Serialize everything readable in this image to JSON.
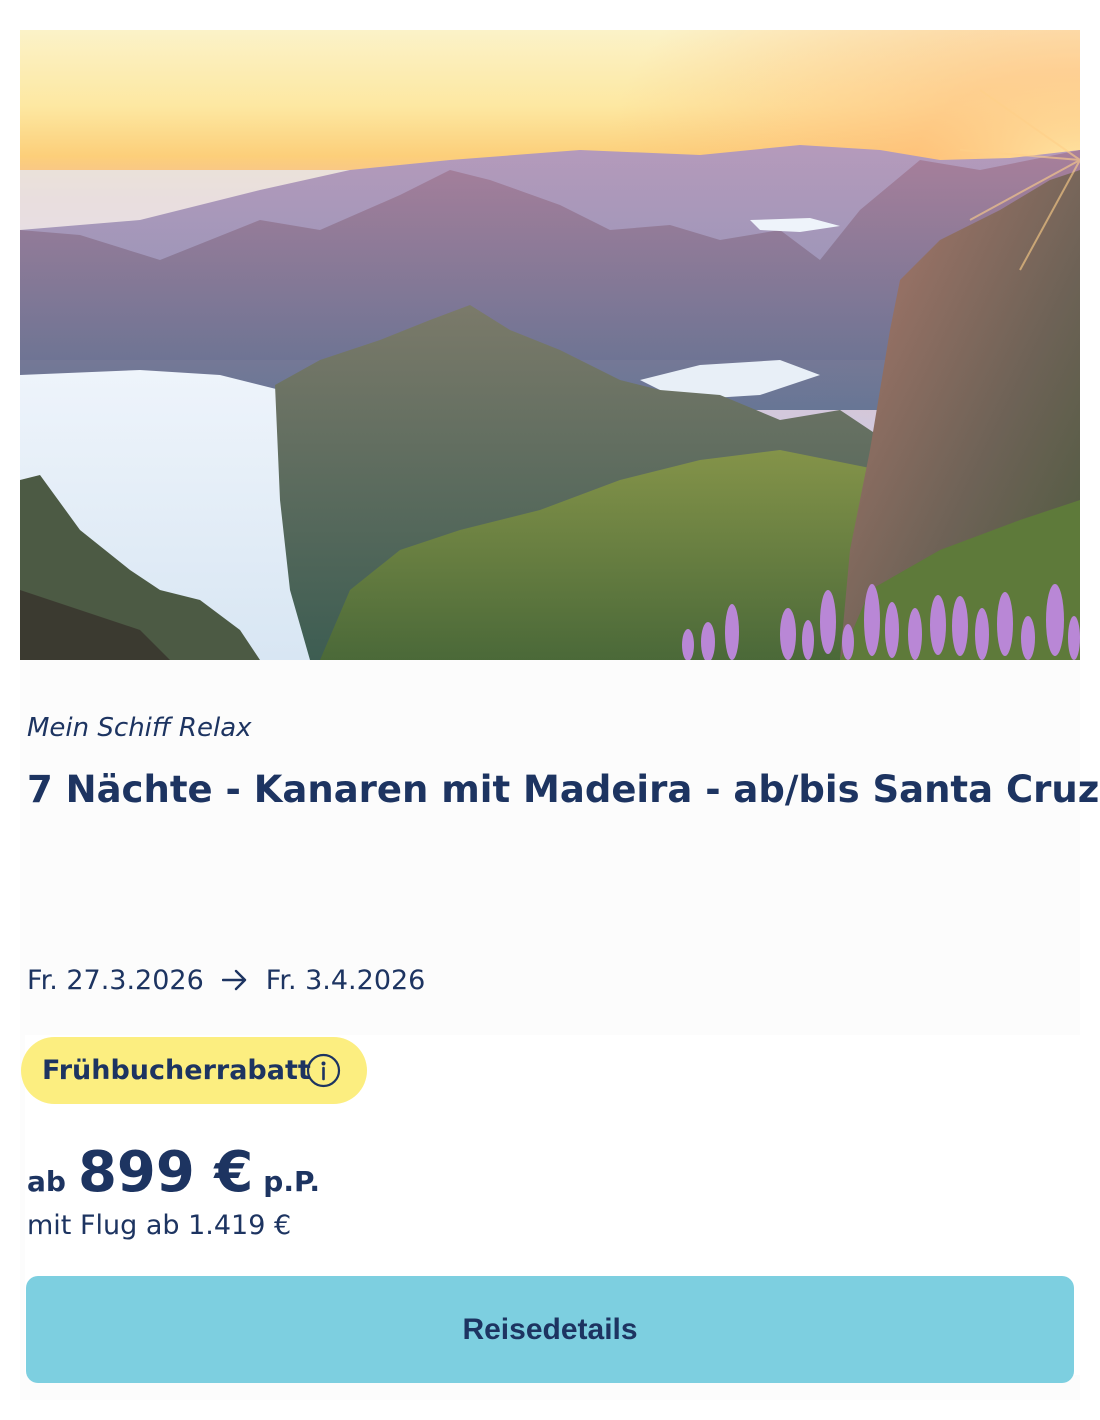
{
  "card": {
    "image": {
      "description_icon": "landscape-photo"
    },
    "ship_name": "Mein Schiff Relax",
    "title": "7 Nächte - Kanaren mit Madeira - ab/bis Santa Cruz",
    "dates": {
      "start": "Fr. 27.3.2026",
      "end": "Fr. 3.4.2026",
      "separator_icon": "arrow-right-icon"
    },
    "badge": {
      "label": "Frühbucherrabatt",
      "icon": "info-icon",
      "color": "#fcee80"
    },
    "price": {
      "prefix": "ab",
      "amount": "899 €",
      "suffix": "p.P.",
      "with_flight": "mit Flug ab 1.419 €"
    },
    "cta": {
      "label": "Reisedetails",
      "color": "#7dcfe0"
    },
    "text_color": "#1d3461"
  }
}
